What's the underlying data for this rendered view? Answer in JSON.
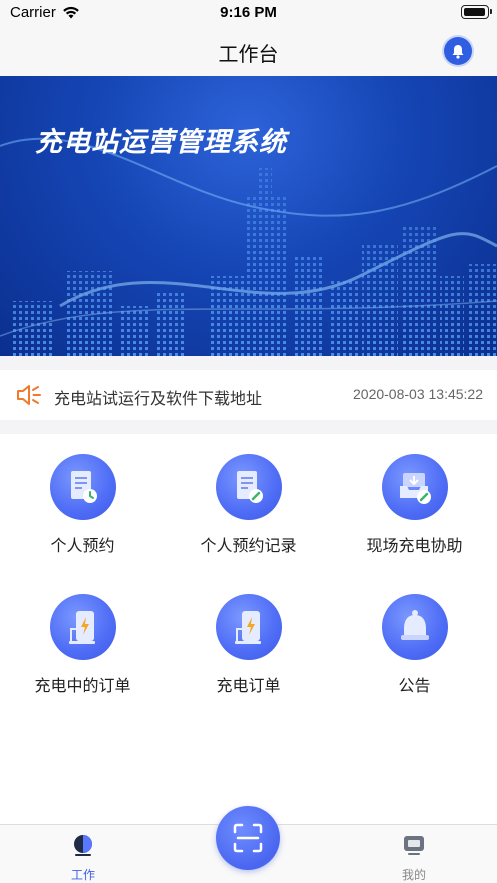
{
  "status_bar": {
    "carrier": "Carrier",
    "time": "9:16 PM"
  },
  "nav": {
    "title": "工作台"
  },
  "banner": {
    "title": "充电站运营管理系统"
  },
  "notice": {
    "text": "充电站试运行及软件下载地址",
    "time": "2020-08-03 13:45:22"
  },
  "features": [
    {
      "label": "个人预约",
      "icon": "document-clock-icon"
    },
    {
      "label": "个人预约记录",
      "icon": "document-edit-icon"
    },
    {
      "label": "现场充电协助",
      "icon": "tray-edit-icon"
    },
    {
      "label": "充电中的订单",
      "icon": "charger-icon"
    },
    {
      "label": "充电订单",
      "icon": "charger-icon"
    },
    {
      "label": "公告",
      "icon": "bell-icon"
    }
  ],
  "tabs": [
    {
      "label": "工作",
      "active": true,
      "icon": "workbench-icon"
    },
    {
      "label": "我的",
      "active": false,
      "icon": "monitor-icon"
    }
  ],
  "colors": {
    "accent": "#4e6cf5",
    "tab_active": "#3f5fe6",
    "tab_inactive": "#888888",
    "speaker": "#f07a2a"
  }
}
